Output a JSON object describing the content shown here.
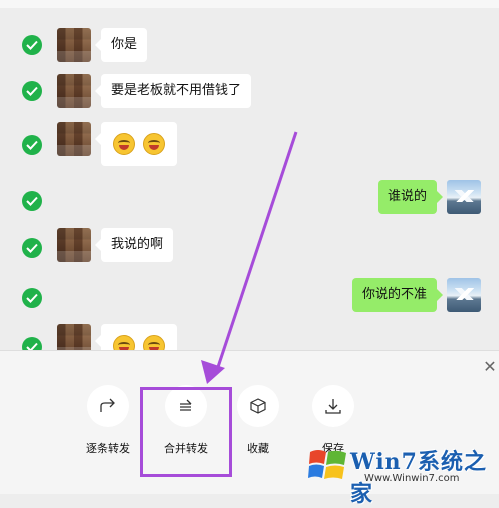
{
  "messages": [
    {
      "side": "left",
      "text": "你是"
    },
    {
      "side": "left",
      "text": "要是老板就不用借钱了"
    },
    {
      "side": "left",
      "emoji_count": 2
    },
    {
      "side": "right",
      "text": "谁说的"
    },
    {
      "side": "left",
      "text": "我说的啊"
    },
    {
      "side": "right",
      "text": "你说的不准"
    },
    {
      "side": "left",
      "emoji_count": 2
    }
  ],
  "actions": [
    {
      "label": "逐条转发",
      "icon": "share-icon"
    },
    {
      "label": "合并转发",
      "icon": "merge-forward-icon"
    },
    {
      "label": "收藏",
      "icon": "cube-icon"
    },
    {
      "label": "保存",
      "icon": "download-icon"
    }
  ],
  "watermark": {
    "brand": "Win7系统之家",
    "url": "Www.Winwin7.com"
  },
  "colors": {
    "check": "#20b24a",
    "bubble_right": "#95ec69",
    "highlight": "#a64cd9"
  }
}
